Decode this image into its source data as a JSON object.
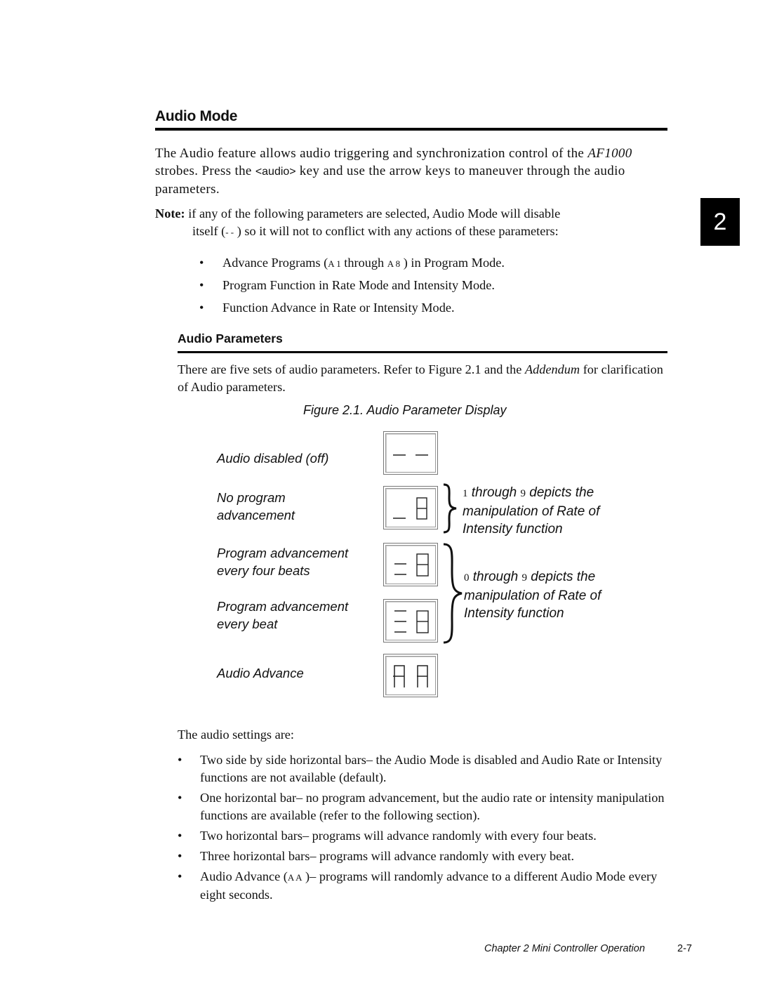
{
  "section": {
    "title": "Audio Mode",
    "intro": {
      "part1": "The Audio feature allows audio triggering and synchronization control of the ",
      "product": "AF1000",
      "part2": " strobes. Press the ",
      "key": "<audio>",
      "part3": " key and use the arrow keys to maneuver through the audio parameters."
    },
    "note": {
      "label": "Note:",
      "line1": " if any of the following parameters are selected, Audio Mode will disable",
      "line2_a": "itself (",
      "line2_code": "- -",
      "line2_b": " ) so it will not to conflict with any actions of these parameters:"
    },
    "bullets": [
      {
        "a": "Advance Programs (",
        "code1": "A 1",
        "b": "  through ",
        "code2": "A 8",
        "c": " ) in Program Mode."
      },
      {
        "text": "Program Function in Rate Mode and Intensity Mode."
      },
      {
        "text": "Function Advance in Rate or Intensity Mode."
      }
    ],
    "bullet_glyph": "•"
  },
  "chapter_tab": "2",
  "subsection": {
    "title": "Audio Parameters",
    "para_a": "There are five sets of audio parameters. Refer to Figure 2.1 and the ",
    "para_italic": "Addendum",
    "para_b": " for clarification of Audio parameters."
  },
  "figure": {
    "caption": "Figure 2.1.  Audio Parameter Display",
    "rows": [
      {
        "label1": "Audio disabled (off)",
        "label2": "",
        "display": "- -"
      },
      {
        "label1": "No program",
        "label2": "advancement",
        "display": "_ 8"
      },
      {
        "label1": "Program advancement",
        "label2": "every four beats",
        "display": "= 8"
      },
      {
        "label1": "Program advancement",
        "label2": "every beat",
        "display": "≡ 8"
      },
      {
        "label1": "Audio Advance",
        "label2": "",
        "display": "A A"
      }
    ],
    "brace1": {
      "from": "1",
      "through": " through ",
      "to": "9",
      "rest1": "  depicts the",
      "line2": "manipulation of Rate of",
      "line3": "Intensity function"
    },
    "brace2": {
      "from": "0",
      "through": "  through ",
      "to": "9",
      "rest1": "  depicts the",
      "line2": "manipulation of Rate of",
      "line3": "Intensity function"
    }
  },
  "settings": {
    "intro": "The audio settings are:",
    "items": [
      {
        "text": "Two side by side horizontal bars– the Audio Mode is disabled and Audio Rate or Intensity functions are not available (default)."
      },
      {
        "text": "One horizontal bar– no program advancement, but the audio rate or intensity manipulation functions are available (refer to the following section)."
      },
      {
        "text": "Two horizontal bars– programs will advance randomly with every four beats."
      },
      {
        "text": "Three horizontal bars– programs will advance randomly with every beat."
      },
      {
        "a": "Audio Advance (",
        "code": "A A",
        "b": " )– programs will randomly advance to a different Audio Mode every eight seconds."
      }
    ]
  },
  "footer": {
    "chapter": "Chapter 2 Mini Controller Operation",
    "page": "2-7"
  }
}
